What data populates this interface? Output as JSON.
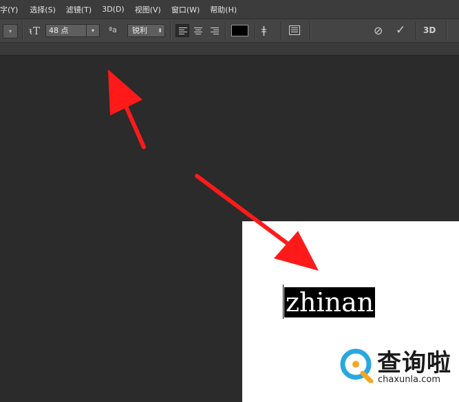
{
  "menu": {
    "items": [
      "字(Y)",
      "选择(S)",
      "滤镜(T)",
      "3D(D)",
      "视图(V)",
      "窗口(W)",
      "帮助(H)"
    ]
  },
  "options_bar": {
    "font_size_value": "48 点",
    "antialias_value": "锐利",
    "text_color": "#000000",
    "three_d_label": "3D",
    "icons": [
      "text-orientation-icon",
      "antialias-icon",
      "align-left-icon",
      "align-center-icon",
      "align-right-icon",
      "warp-text-icon",
      "character-panel-icon",
      "cancel-icon",
      "commit-icon"
    ]
  },
  "canvas": {
    "text": "zhinan",
    "background": "#2b2b2b",
    "document_color": "#ffffff"
  },
  "annotation": {
    "arrow_color": "#ff1a1a"
  },
  "watermark": {
    "name": "查询啦",
    "url": "chaxunla.com",
    "colors": {
      "ring": "#29a8e0",
      "accent": "#f5a623"
    }
  }
}
